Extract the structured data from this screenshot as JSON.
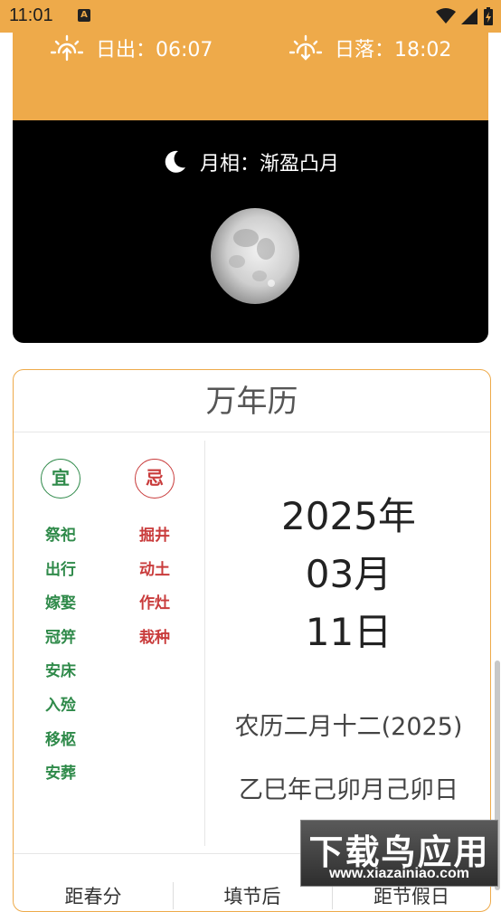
{
  "status_bar": {
    "time": "11:01",
    "badge": "A"
  },
  "sun": {
    "sunrise_label": "日出：06:07",
    "sunset_label": "日落：18:02"
  },
  "moon": {
    "phase_label": "月相：渐盈凸月"
  },
  "calendar": {
    "title": "万年历",
    "yi_badge": "宜",
    "ji_badge": "忌",
    "yi_items": [
      "祭祀",
      "出行",
      "嫁娶",
      "冠笄",
      "安床",
      "入殓",
      "移柩",
      "安葬"
    ],
    "ji_items": [
      "掘井",
      "动土",
      "作灶",
      "栽种"
    ],
    "year": "2025年",
    "month": "03月",
    "day": "11日",
    "lunar_date": "农历二月十二(2025)",
    "ganzhi": "乙巳年己卯月己卯日",
    "bottom_tabs": [
      "距春分",
      "填节后",
      "距节假日"
    ]
  },
  "watermark": {
    "main": "下载鸟应用",
    "sub": "www.xiazainiao.com"
  },
  "colors": {
    "accent_orange": "#eeaa4a",
    "yi_green": "#2f8a4a",
    "ji_red": "#c93c3c"
  }
}
